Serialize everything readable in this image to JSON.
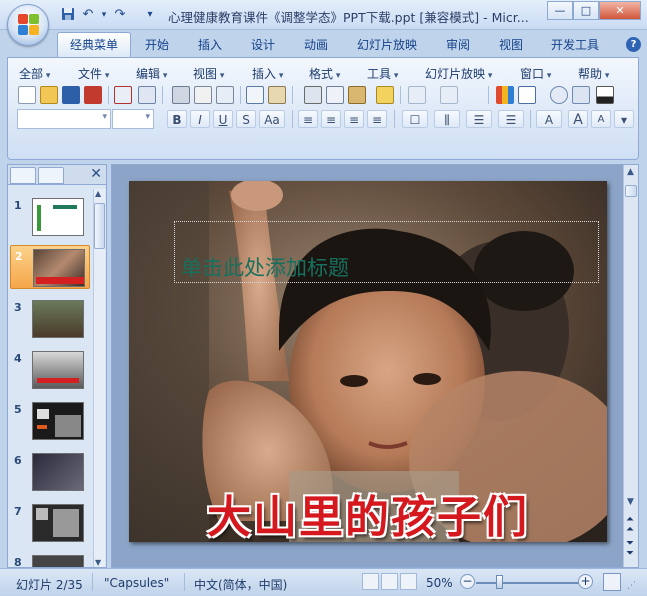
{
  "window": {
    "title": "心理健康教育课件《调整学态》PPT下载.ppt [兼容模式] - Micr...",
    "minimize": "—",
    "maximize": "□",
    "close": "✕"
  },
  "quick_access": {
    "save_icon": "save-icon",
    "undo_icon": "undo-icon",
    "redo_icon": "redo-icon",
    "customize": "▾"
  },
  "ribbon_tabs": [
    "经典菜单",
    "开始",
    "插入",
    "设计",
    "动画",
    "幻灯片放映",
    "审阅",
    "视图",
    "开发工具"
  ],
  "help": "?",
  "classic_menu": [
    "全部",
    "文件",
    "编辑",
    "视图",
    "插入",
    "格式",
    "工具",
    "幻灯片放映",
    "窗口",
    "帮助"
  ],
  "format_buttons": [
    "B",
    "I",
    "U",
    "S",
    "Aa"
  ],
  "font_size_buttons": [
    "A",
    "A",
    "A"
  ],
  "slides_pane": {
    "slides": [
      {
        "num": "1"
      },
      {
        "num": "2",
        "selected": true
      },
      {
        "num": "3"
      },
      {
        "num": "4"
      },
      {
        "num": "5"
      },
      {
        "num": "6"
      },
      {
        "num": "7"
      },
      {
        "num": "8"
      }
    ]
  },
  "slide": {
    "title_placeholder": "单击此处添加标题",
    "banner": "大山里的孩子们"
  },
  "statusbar": {
    "slide_info": "幻灯片 2/35",
    "theme": "\"Capsules\"",
    "language": "中文(简体，中国)",
    "zoom": "50%",
    "zoom_minus": "−",
    "zoom_plus": "+",
    "zoom_level": 0.5
  },
  "colors": {
    "accent": "#15428b",
    "selected_thumb": "#f5a64a",
    "title_text": "#17705e",
    "banner_text": "#d4181e"
  }
}
